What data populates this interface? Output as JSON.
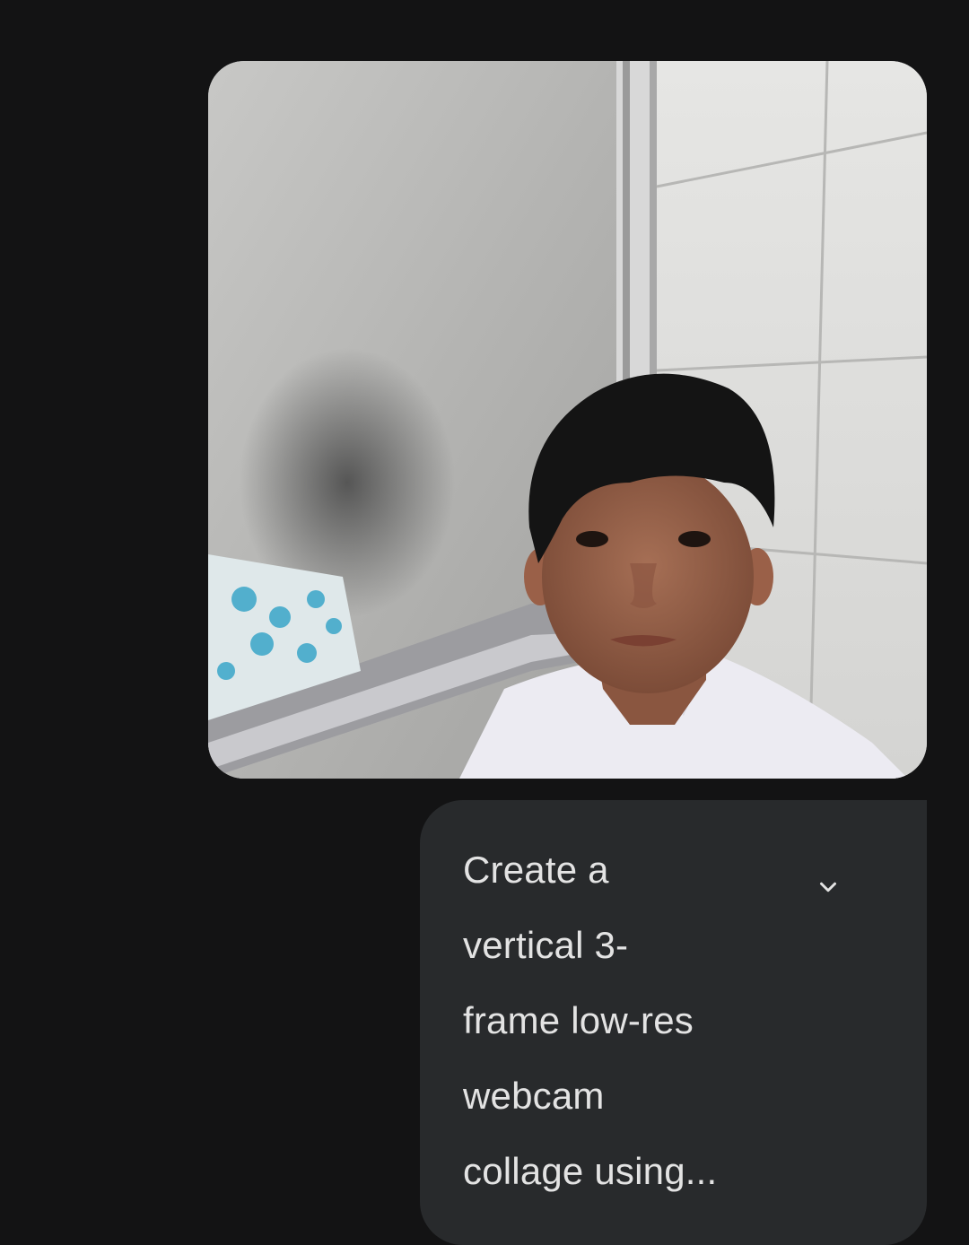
{
  "message": {
    "image": {
      "alt": ""
    },
    "prompt": {
      "text": "Create a\nvertical 3-\nframe low-res\nwebcam\ncollage using..."
    },
    "expand_icon": "chevron-down-icon"
  },
  "colors": {
    "background": "#131314",
    "bubble": "#282a2c",
    "text": "#e3e3e3"
  }
}
